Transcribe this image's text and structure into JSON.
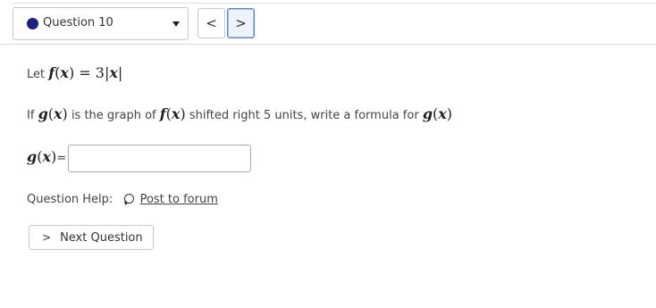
{
  "nav": {
    "question_label": "Question 10",
    "prev_symbol": "<",
    "next_symbol": ">",
    "dot_color": "#1a237e"
  },
  "question": {
    "line1": {
      "text": "Let",
      "func": "f",
      "var": "x",
      "eq": "= 3|",
      "close": "|"
    },
    "line2": {
      "t1": "If",
      "g": "g",
      "x": "x",
      "t2": "is the graph of",
      "f": "f",
      "t3": "shifted right 5 units, write a formula for"
    },
    "answer_label_suffix": "=",
    "answer_value": ""
  },
  "help": {
    "label": "Question Help:",
    "forum_link": "Post to forum"
  },
  "next_question": {
    "label": "Next Question",
    "chevron": ">"
  }
}
